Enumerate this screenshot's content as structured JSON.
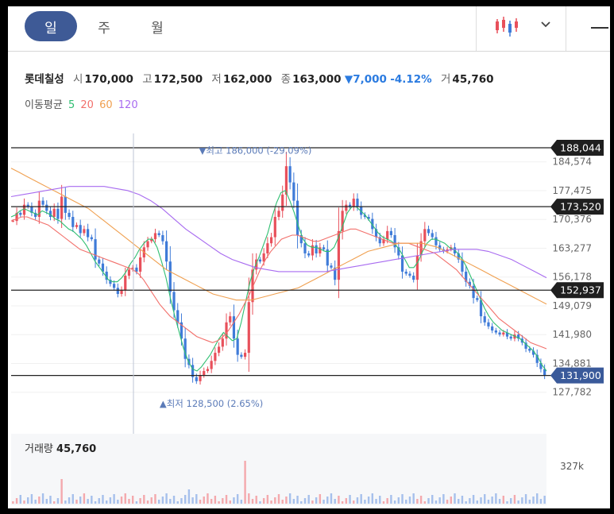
{
  "tabs": [
    {
      "label": "일",
      "active": true
    },
    {
      "label": "주",
      "active": false
    },
    {
      "label": "월",
      "active": false
    }
  ],
  "toolbar": {
    "chart_type_icon": "candlestick-icon",
    "dropdown_icon": "chevron-down-icon",
    "menu_icon": "dash-icon"
  },
  "quote": {
    "name": "롯데칠성",
    "open_label": "시",
    "open": "170,000",
    "high_label": "고",
    "high": "172,500",
    "low_label": "저",
    "low": "162,000",
    "close_label": "종",
    "close": "163,000",
    "change": "▼7,000",
    "change_pct": "-4.12%",
    "volume_label": "거",
    "volume": "45,760"
  },
  "ma_legend": {
    "title": "이동평균",
    "items": [
      "5",
      "20",
      "60",
      "120"
    ]
  },
  "volume_panel": {
    "label": "거래량",
    "value": "45,760",
    "axis_tick": "327k"
  },
  "colors": {
    "up": "#e8505b",
    "down": "#3f7bd8",
    "ma5": "#2fbf71",
    "ma20": "#f2706b",
    "ma60": "#f0a050",
    "ma120": "#a86bf0",
    "accent": "#3e5a96",
    "price_tag": "#3a5a9a"
  },
  "chart_data": {
    "type": "line",
    "ylim": [
      124000,
      190000
    ],
    "y_ticks": [
      "184,574",
      "177,475",
      "170,376",
      "163,277",
      "156,178",
      "149,079",
      "141,980",
      "134,881",
      "127,782"
    ],
    "y_tick_values": [
      184574,
      177475,
      170376,
      163277,
      156178,
      149079,
      141980,
      134881,
      127782
    ],
    "level_lines": [
      {
        "label": "188,044",
        "value": 188044
      },
      {
        "label": "173,520",
        "value": 173520
      },
      {
        "label": "152,937",
        "value": 152937
      },
      {
        "label": "131,900",
        "value": 131900
      }
    ],
    "current_price": {
      "label": "131,900",
      "value": 131900
    },
    "max_annotation": {
      "text": "▼최고 186,000 (-29.09%)",
      "value": 186000,
      "index": 66
    },
    "min_annotation": {
      "text": "▲최저 128,500 (2.65%)",
      "value": 128500,
      "index": 40
    },
    "series": [
      {
        "values": [
          170000,
          172000,
          171500,
          174000,
          173500,
          172000,
          171000,
          175000,
          174000,
          172500,
          171000,
          173000,
          170500,
          176000,
          172000,
          171000,
          168500,
          169000,
          167000,
          168000,
          166000,
          165500,
          160500,
          159500,
          157500,
          155500,
          154500,
          153500,
          152000,
          153000,
          156500,
          158000,
          158500,
          157500,
          161000,
          163500,
          165000,
          165500,
          167000,
          166500,
          165000,
          160000,
          152500,
          148000,
          145000,
          141000,
          136000,
          134500,
          131500,
          130500,
          132000,
          133000,
          133500,
          135500,
          137500,
          139000,
          141000,
          145000,
          146500,
          141000,
          137000,
          136500,
          137500,
          150000,
          158000,
          160500,
          160000,
          162000,
          164500,
          166000,
          171000,
          172500,
          176500,
          183500,
          179500,
          175000,
          166500,
          164500,
          162000,
          161500,
          164000,
          162000,
          163500,
          163000,
          159000,
          158500,
          155500,
          167500,
          172500,
          174000,
          173500,
          175500,
          173500,
          171500,
          171000,
          170500,
          168000,
          166000,
          164500,
          165500,
          167500,
          166500,
          163500,
          161500,
          157500,
          157000,
          156500,
          155500,
          161500,
          165000,
          168000,
          167000,
          166000,
          164000,
          163000,
          162500,
          163000,
          163500,
          162000,
          160500,
          157500,
          155000,
          154000,
          151000,
          150500,
          146500,
          145000,
          144000,
          143000,
          142500,
          142000,
          142500,
          141500,
          141000,
          142000,
          141000,
          140000,
          138500,
          138000,
          137000,
          135000,
          133500,
          131900
        ]
      },
      {
        "name": "5",
        "values": [
          171000,
          171500,
          172500,
          173000,
          172500,
          172000,
          171500,
          172500,
          172000,
          171500,
          170500,
          170000,
          169000,
          168000,
          167500,
          166500,
          165500,
          164000,
          162000,
          160000,
          158500,
          157000,
          155500,
          155000,
          155000,
          156000,
          157500,
          159500,
          161000,
          163000,
          164500,
          165500,
          165500,
          163500,
          160000,
          156000,
          151000,
          146500,
          142500,
          138500,
          135500,
          133500,
          133000,
          134000,
          135500,
          137000,
          139000,
          141000,
          142500,
          141500,
          140500,
          141000,
          145000,
          150000,
          155000,
          158500,
          161000,
          164000,
          167000,
          171000,
          174500,
          177000,
          177500,
          175000,
          172000,
          168500,
          165500,
          164000,
          163500,
          163500,
          163000,
          162500,
          162500,
          163500,
          166000,
          169000,
          172000,
          173500,
          173500,
          172500,
          171500,
          170000,
          168500,
          167000,
          166000,
          165500,
          165000,
          164000,
          162500,
          160500,
          158500,
          158500,
          160000,
          162500,
          164500,
          165500,
          165500,
          165000,
          164500,
          163500,
          163000,
          162000,
          160500,
          158500,
          156000,
          153500,
          151000,
          148500,
          146500,
          145000,
          144000,
          143000,
          142500,
          142000,
          141500,
          141000,
          140000,
          139000,
          138000,
          136500,
          134500,
          133000
        ]
      },
      {
        "name": "20",
        "values": [
          170000,
          170500,
          171000,
          171000,
          170500,
          170000,
          169500,
          169000,
          168000,
          167000,
          166000,
          165000,
          164000,
          163000,
          162500,
          162000,
          161500,
          161000,
          160500,
          160000,
          159500,
          159000,
          158500,
          158000,
          157000,
          155500,
          153500,
          151500,
          149500,
          148000,
          146500,
          145500,
          144500,
          143500,
          142500,
          141500,
          141000,
          140500,
          140000,
          140500,
          141500,
          143000,
          145000,
          147000,
          149500,
          152000,
          155000,
          158000,
          160500,
          162500,
          164000,
          165500,
          166000,
          166500,
          166500,
          166000,
          165500,
          165000,
          165000,
          165500,
          166000,
          166500,
          167000,
          167500,
          168000,
          168000,
          167500,
          167000,
          166500,
          166000,
          165500,
          165000,
          164500,
          164500,
          164500,
          164500,
          164000,
          163500,
          163000,
          162500,
          162000,
          161000,
          160000,
          159000,
          158000,
          156500,
          155000,
          153500,
          152000,
          150500,
          149000,
          147500,
          146000,
          145000,
          144000,
          143000,
          142000,
          141000,
          140000,
          139500,
          139000,
          138500
        ]
      },
      {
        "name": "60",
        "values": [
          183000,
          182000,
          181000,
          180000,
          179000,
          178000,
          177000,
          176000,
          175000,
          174000,
          173000,
          171500,
          170000,
          168500,
          167000,
          165500,
          164000,
          162500,
          161000,
          159500,
          158000,
          157000,
          156000,
          155000,
          154000,
          153000,
          152000,
          151500,
          151000,
          150500,
          150500,
          150500,
          151000,
          151500,
          152000,
          152500,
          153000,
          153500,
          154500,
          155500,
          156500,
          157500,
          158500,
          159500,
          160500,
          161500,
          162500,
          163000,
          163500,
          164000,
          164500,
          164500,
          164500,
          164500,
          164000,
          163500,
          162500,
          161500,
          160500,
          159500,
          158500,
          157500,
          156500,
          155500,
          154500,
          153500,
          152500,
          151500,
          150500,
          149500
        ]
      },
      {
        "name": "120",
        "values": [
          176000,
          176500,
          177000,
          177500,
          178000,
          178500,
          178500,
          178500,
          178500,
          178000,
          177500,
          176500,
          175000,
          173000,
          170500,
          168000,
          166000,
          164000,
          162000,
          160500,
          159500,
          158500,
          158000,
          157500,
          157500,
          157500,
          157500,
          157500,
          158000,
          158500,
          159000,
          159500,
          160000,
          160500,
          161000,
          161500,
          162000,
          162500,
          163000,
          163000,
          163000,
          162500,
          161500,
          160500,
          159000,
          157500,
          156000
        ]
      }
    ]
  }
}
